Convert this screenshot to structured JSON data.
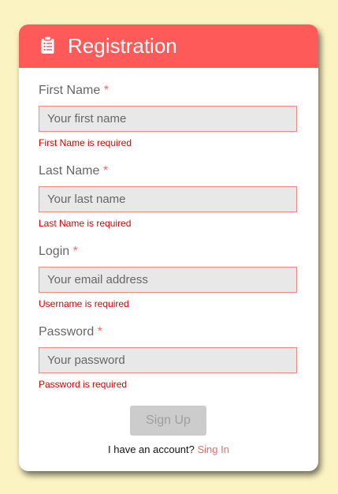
{
  "header": {
    "title": "Registration",
    "icon": "clipboard-icon"
  },
  "fields": [
    {
      "label": "First Name",
      "required_mark": "*",
      "placeholder": "Your first name",
      "value": "",
      "error": "First Name is required"
    },
    {
      "label": "Last Name",
      "required_mark": "*",
      "placeholder": "Your last name",
      "value": "",
      "error": "Last Name is required"
    },
    {
      "label": "Login",
      "required_mark": "*",
      "placeholder": "Your email address",
      "value": "",
      "error": "Username is required"
    },
    {
      "label": "Password",
      "required_mark": "*",
      "placeholder": "Your password",
      "value": "",
      "error": "Password is required"
    }
  ],
  "actions": {
    "signup_label": "Sign Up",
    "account_text": "I have an account?",
    "signin_label": "Sing In"
  },
  "colors": {
    "page_background": "#FBF3C2",
    "header": "#FF5A5A",
    "error": "#E00000",
    "link": "#F06A6A",
    "input_border": "#F0897F",
    "button_disabled": "#CCCCCC"
  }
}
